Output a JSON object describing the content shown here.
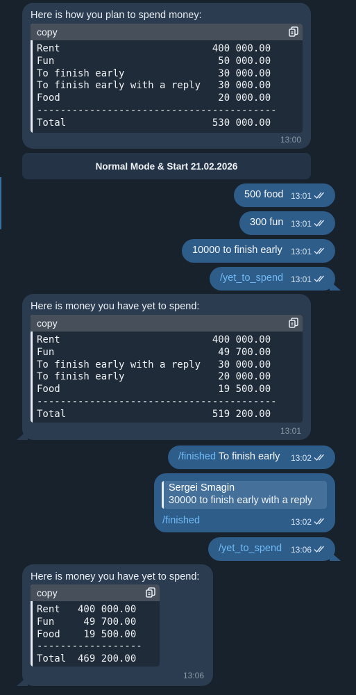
{
  "msg1": {
    "text": "Here is how you plan to spend money:",
    "code_label": "copy",
    "code": "Rent                          400 000.00\nFun                            50 000.00\nTo finish early                30 000.00\nTo finish early with a reply   30 000.00\nFood                           20 000.00\n-----------------------------------------\nTotal                         530 000.00",
    "time": "13:00"
  },
  "service": {
    "text": "Normal Mode & Start 21.02.2026"
  },
  "out1": {
    "text": "500 food",
    "time": "13:01"
  },
  "out2": {
    "text": "300 fun",
    "time": "13:01"
  },
  "out3": {
    "text": "10000 to finish early",
    "time": "13:01"
  },
  "out4": {
    "command": "/yet_to_spend",
    "time": "13:01"
  },
  "msg2": {
    "text": "Here is money you have yet to spend:",
    "code_label": "copy",
    "code": "Rent                          400 000.00\nFun                            49 700.00\nTo finish early with a reply   30 000.00\nTo finish early                20 000.00\nFood                           19 500.00\n-----------------------------------------\nTotal                         519 200.00",
    "time": "13:01"
  },
  "out5": {
    "command": "/finished",
    "text": " To finish early",
    "time": "13:02"
  },
  "reply": {
    "quote_name": "Sergei Smagin",
    "quote_text": "30000 to finish early with a reply",
    "command": "/finished",
    "time": "13:02"
  },
  "out6": {
    "command": "/yet_to_spend",
    "time": "13:06"
  },
  "msg3": {
    "text": "Here is money you have yet to spend:",
    "code_label": "copy",
    "code": "Rent   400 000.00\nFun     49 700.00\nFood    19 500.00\n------------------\nTotal  469 200.00",
    "time": "13:06"
  },
  "icons": {
    "copy": "copy-icon",
    "read": "double-check-icon"
  },
  "colors": {
    "background": "#18222d",
    "incoming": "#2b3c50",
    "outgoing": "#2f5d8a",
    "command": "#6fb9f5"
  }
}
